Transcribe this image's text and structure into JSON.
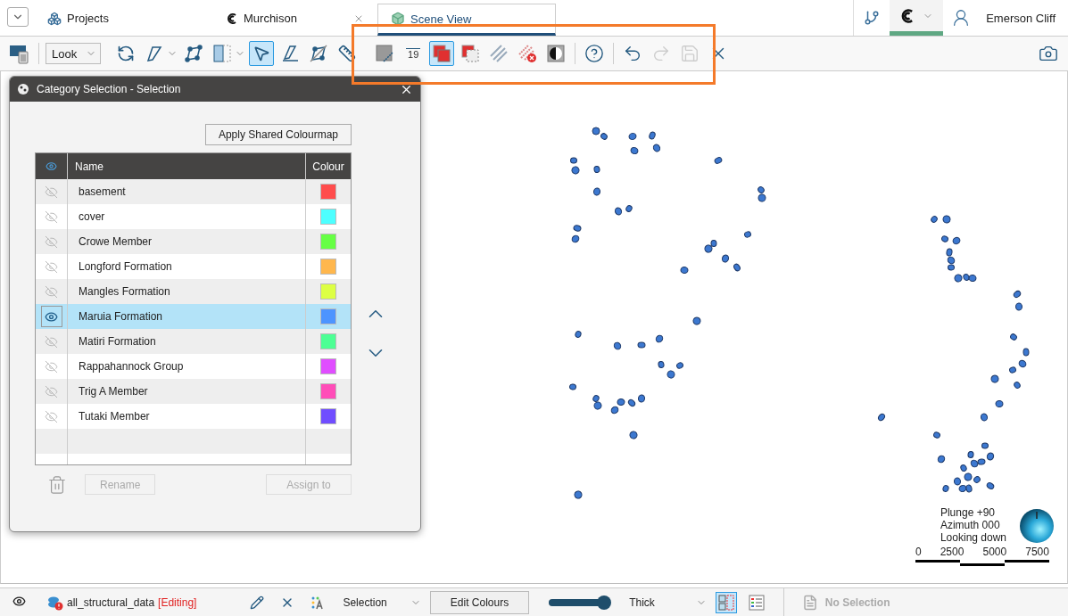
{
  "top_bar": {
    "tabs": [
      {
        "label": "Projects",
        "selected": false
      },
      {
        "label": "Murchison",
        "selected": false
      },
      {
        "label": "Scene View",
        "selected": true
      }
    ],
    "user": "Emerson Cliff"
  },
  "toolbar": {
    "leading_tools": [
      {
        "selected": false
      }
    ],
    "view_mode": "Look",
    "tools": [
      {
        "selected": false
      },
      {
        "selected": false
      },
      {
        "selected": false
      },
      {
        "selected": false
      },
      {
        "selected": true
      },
      {
        "selected": false
      },
      {
        "selected": false
      },
      {
        "selected": false
      }
    ],
    "edit_tools": [
      {
        "selected": false,
        "disabled": false
      },
      {
        "selected": false,
        "disabled": false,
        "label": "19"
      },
      {
        "selected": true,
        "disabled": false
      },
      {
        "selected": false,
        "disabled": false
      },
      {
        "selected": false,
        "disabled": false
      },
      {
        "selected": false,
        "disabled": false
      },
      {
        "selected": false,
        "disabled": false
      },
      {
        "selected": false,
        "disabled": false
      },
      {
        "selected": false,
        "disabled": false
      },
      {
        "selected": false,
        "disabled": true
      },
      {
        "selected": false,
        "disabled": true
      },
      {
        "selected": false,
        "disabled": false
      }
    ]
  },
  "dialog": {
    "title": "Category Selection - Selection",
    "apply_button": "Apply Shared Colourmap",
    "columns": [
      "Name",
      "Colour"
    ],
    "rows": [
      {
        "name": "basement",
        "color": "#ff4d4d",
        "visible": false,
        "selected": false
      },
      {
        "name": "cover",
        "color": "#4dffff",
        "visible": false,
        "selected": false
      },
      {
        "name": "Crowe Member",
        "color": "#66ff44",
        "visible": false,
        "selected": false
      },
      {
        "name": "Longford Formation",
        "color": "#ffb74d",
        "visible": false,
        "selected": false
      },
      {
        "name": "Mangles Formation",
        "color": "#ddff44",
        "visible": false,
        "selected": false
      },
      {
        "name": "Maruia Formation",
        "color": "#4d94ff",
        "visible": true,
        "selected": true
      },
      {
        "name": "Matiri Formation",
        "color": "#4dff94",
        "visible": false,
        "selected": false
      },
      {
        "name": "Rappahannock Group",
        "color": "#e04dff",
        "visible": false,
        "selected": false
      },
      {
        "name": "Trig A Member",
        "color": "#ff4db8",
        "visible": false,
        "selected": false
      },
      {
        "name": "Tutaki Member",
        "color": "#704dff",
        "visible": false,
        "selected": false
      }
    ],
    "rename_button": {
      "label": "Rename",
      "disabled": true
    },
    "assign_button": {
      "label": "Assign to",
      "disabled": true
    }
  },
  "orientation": {
    "lines": [
      "Plunge +90",
      "Azimuth 000",
      "Looking down"
    ],
    "scale_labels": [
      "0",
      "2500",
      "5000",
      "7500"
    ]
  },
  "status_bar": {
    "visible": true,
    "dataset": "all_structural_data",
    "dataset_status": "[Editing]",
    "mode": "Selection",
    "edit_colours_button": "Edit Colours",
    "thickness_slider": {
      "level": 1.0
    },
    "thickness": "Thick",
    "views": [
      {
        "selected": true
      },
      {
        "selected": false
      }
    ],
    "selection": "No Selection"
  }
}
